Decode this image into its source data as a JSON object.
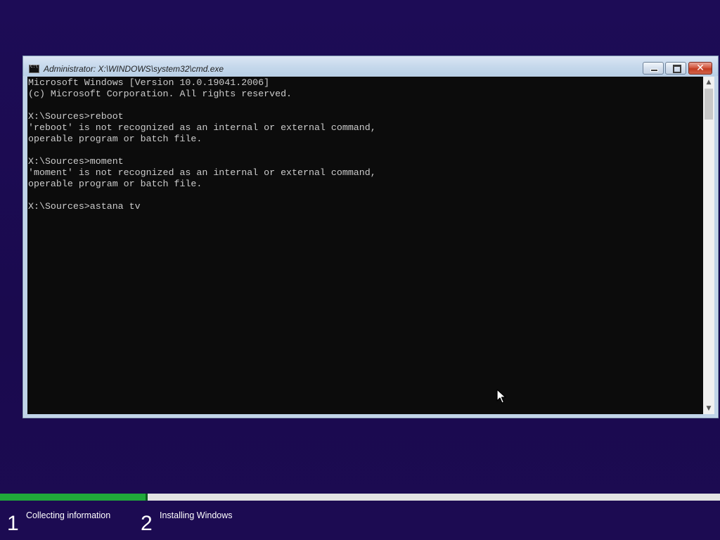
{
  "window": {
    "title": "Administrator: X:\\WINDOWS\\system32\\cmd.exe",
    "icon": "cmd-icon",
    "buttons": {
      "minimize": "minimize-icon",
      "maximize": "maximize-icon",
      "close_label": "✕"
    }
  },
  "console": {
    "lines": [
      "Microsoft Windows [Version 10.0.19041.2006]",
      "(c) Microsoft Corporation. All rights reserved.",
      "",
      "X:\\Sources>reboot",
      "'reboot' is not recognized as an internal or external command,",
      "operable program or batch file.",
      "",
      "X:\\Sources>moment",
      "'moment' is not recognized as an internal or external command,",
      "operable program or batch file.",
      "",
      "X:\\Sources>astana tv"
    ],
    "text_color": "#cccccc",
    "background": "#0c0c0c"
  },
  "scrollbar": {
    "up_glyph": "▲",
    "down_glyph": "▼"
  },
  "setup": {
    "progress_fraction": 0.205,
    "progress_color": "#20a83a",
    "steps": [
      {
        "number": "1",
        "label": "Collecting information"
      },
      {
        "number": "2",
        "label": "Installing Windows"
      }
    ]
  },
  "colors": {
    "desktop_background": "#1c0b52",
    "close_button": "#c94a30"
  }
}
